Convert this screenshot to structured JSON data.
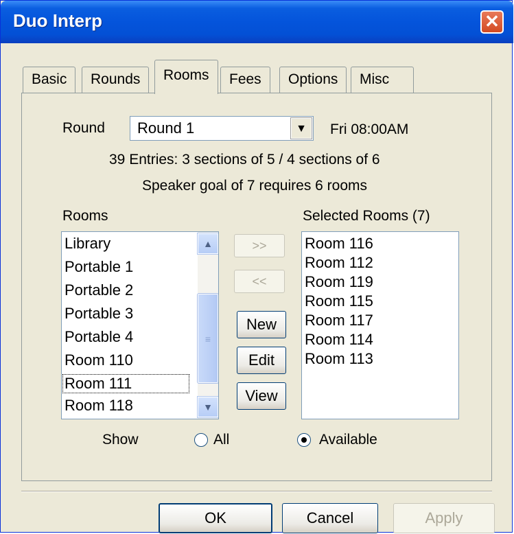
{
  "window": {
    "title": "Duo Interp"
  },
  "tabs": [
    {
      "label": "Basic"
    },
    {
      "label": "Rounds"
    },
    {
      "label": "Rooms",
      "active": true
    },
    {
      "label": "Fees"
    },
    {
      "label": "Options"
    },
    {
      "label": "Misc"
    }
  ],
  "round": {
    "label": "Round",
    "selected": "Round 1",
    "time": "Fri 08:00AM",
    "entries_line": "39 Entries:  3 sections of 5 / 4 sections of 6",
    "goal_line": "Speaker goal of 7 requires 6 rooms"
  },
  "rooms": {
    "label": "Rooms",
    "items": [
      "Library",
      "Portable 1",
      "Portable 2",
      "Portable 3",
      "Portable 4",
      "Room 110",
      "Room 111",
      "Room 118"
    ],
    "focused": "Room 111"
  },
  "selected_rooms": {
    "label": "Selected Rooms (7)",
    "items": [
      "Room 116",
      "Room 112",
      "Room 119",
      "Room 115",
      "Room 117",
      "Room 114",
      "Room 113"
    ]
  },
  "buttons": {
    "add": ">>",
    "remove": "<<",
    "new": "New",
    "edit": "Edit",
    "view": "View",
    "ok": "OK",
    "cancel": "Cancel",
    "apply": "Apply"
  },
  "show": {
    "label": "Show",
    "options": [
      {
        "label": "All",
        "selected": false
      },
      {
        "label": "Available",
        "selected": true
      }
    ]
  },
  "colors": {
    "titlebar": "#0454db",
    "dialog_bg": "#ece9d8",
    "close": "#d34a22"
  }
}
